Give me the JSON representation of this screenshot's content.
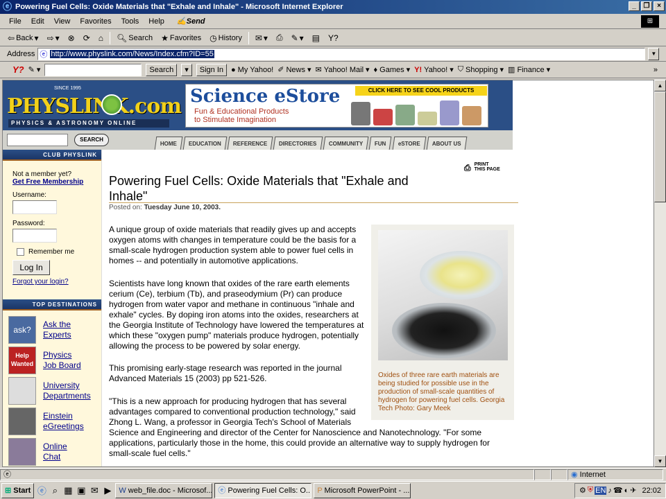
{
  "window": {
    "title": "Powering Fuel Cells: Oxide Materials that \"Exhale and Inhale\" - Microsoft Internet Explorer",
    "buttons": [
      "_",
      "❐",
      "×"
    ]
  },
  "menu": {
    "items": [
      "File",
      "Edit",
      "View",
      "Favorites",
      "Tools",
      "Help"
    ],
    "send": "Send"
  },
  "toolbar": {
    "back": "Back",
    "search": "Search",
    "favorites": "Favorites",
    "history": "History"
  },
  "address": {
    "label": "Address",
    "url": "http://www.physlink.com/News/Index.cfm?ID=55"
  },
  "yahoo": {
    "search_btn": "Search",
    "signin": "Sign In",
    "links": [
      "My Yahoo!",
      "News",
      "Yahoo! Mail",
      "Games",
      "Yahoo!",
      "Shopping",
      "Finance"
    ]
  },
  "site": {
    "since": "SINCE 1995",
    "logo": "PHYSLINK.com",
    "tagline": "PHYSICS & ASTRONOMY ONLINE",
    "estore_title": "Science eStore",
    "estore_sub1": "Fun & Educational Products",
    "estore_sub2": "to Stimulate Imagination",
    "estore_cta": "CLICK HERE TO SEE COOL PRODUCTS",
    "search_btn": "SEARCH",
    "nav": [
      "HOME",
      "EDUCATION",
      "REFERENCE",
      "DIRECTORIES",
      "COMMUNITY",
      "FUN",
      "eSTORE",
      "ABOUT US"
    ]
  },
  "sidebar": {
    "club_header": "CLUB PHYSLINK",
    "not_member": "Not a member yet?",
    "membership_link": "Get Free Membership",
    "username_label": "Username:",
    "password_label": "Password:",
    "remember": "Remember me",
    "login_btn": "Log In",
    "forgot": "Forgot your login?",
    "dest_header": "TOP DESTINATIONS",
    "destinations": [
      {
        "line1": "Ask the",
        "line2": "Experts",
        "img": "ask?"
      },
      {
        "line1": "Physics",
        "line2": "Job Board",
        "img": "Help Wanted"
      },
      {
        "line1": "University",
        "line2": "Departments",
        "img": ""
      },
      {
        "line1": "Einstein",
        "line2": "eGreetings",
        "img": ""
      },
      {
        "line1": "Online",
        "line2": "Chat",
        "img": ""
      }
    ]
  },
  "article": {
    "print_line1": "PRINT",
    "print_line2": "THIS PAGE",
    "headline": "Powering Fuel Cells: Oxide Materials that \"Exhale and Inhale\"",
    "posted_label": "Posted on:",
    "posted_date": "Tuesday June 10, 2003.",
    "p1": "A unique group of oxide materials that readily gives up and accepts oxygen atoms with changes in temperature could be the basis for a small-scale hydrogen production system able to power fuel cells in homes -- and potentially in automotive applications.",
    "p2": "Scientists have long known that oxides of the rare earth elements cerium (Ce), terbium (Tb), and praseodymium (Pr) can produce hydrogen from water vapor and methane in continuous \"inhale and exhale\" cycles. By doping iron atoms into the oxides, researchers at the Georgia Institute of Technology have lowered the temperatures at which these \"oxygen pump\" materials produce hydrogen, potentially allowing the process to be powered by solar energy.",
    "p3": "This promising early-stage research was reported in the journal Advanced Materials 15 (2003) pp 521-526.",
    "p4a": "\"This is a new approach for producing hydrogen that has several advantages compared to conventional production technology,\" said Zhong L. Wang, a professor in Georgia Tech's School of Materials",
    "p4b": "Science and Engineering and director of the Center for Nanoscience and Nanotechnology. \"For some applications, particularly those in the home, this could provide an alternative way to supply hydrogen for small-scale fuel cells.\"",
    "caption": "Oxides of three rare earth materials are being studied for possible use in the production of small-scale quantities of hydrogen for powering fuel cells. Georgia Tech Photo: Gary Meek"
  },
  "status": {
    "zone": "Internet"
  },
  "taskbar": {
    "start": "Start",
    "tasks": [
      "web_file.doc - Microsof...",
      "Powering Fuel Cells: O...",
      "Microsoft PowerPoint - ..."
    ],
    "clock": "22:02",
    "lang": "EN"
  }
}
